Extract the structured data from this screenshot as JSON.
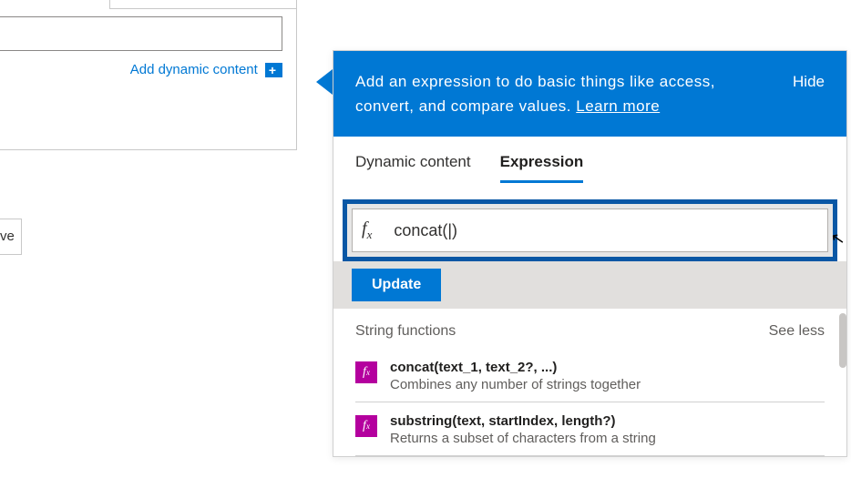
{
  "left": {
    "add_dynamic": "Add dynamic content",
    "save_fragment": "ve"
  },
  "panel": {
    "header_desc_line1": "Add an expression to do basic things like access,",
    "header_desc_line2": "convert, and compare values.",
    "learn_more": "Learn more",
    "hide": "Hide",
    "tabs": {
      "dynamic": "Dynamic content",
      "expression": "Expression"
    },
    "fx_label": "fx",
    "formula": "concat(|)",
    "update": "Update",
    "section_title": "String functions",
    "see_less": "See less",
    "functions": [
      {
        "signature": "concat(text_1, text_2?, ...)",
        "description": "Combines any number of strings together"
      },
      {
        "signature": "substring(text, startIndex, length?)",
        "description": "Returns a subset of characters from a string"
      }
    ]
  }
}
